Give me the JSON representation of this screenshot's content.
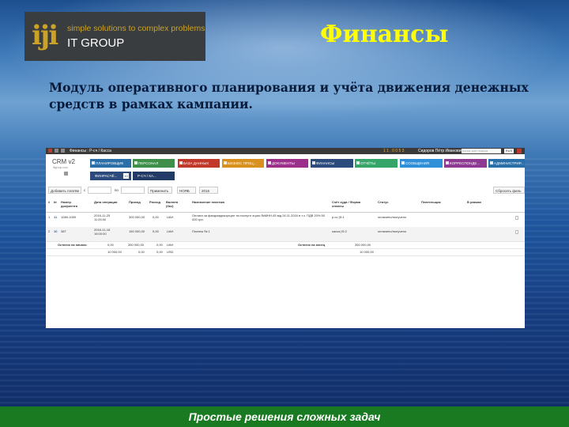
{
  "logo": {
    "mark": "iji",
    "tagline": "simple solutions to complex problems",
    "name": "IT GROUP"
  },
  "slide": {
    "title": "Финансы",
    "subtitle": "Модуль оперативного планирования и учёта движения денежных средств в рамках кампании."
  },
  "app": {
    "window_title": "Финансы : Р-сч / Касса",
    "counters": "1 1 . 0 0 5 3",
    "user": "Сидоров Пётр Иванович",
    "search_placeholder": "поиск для поиска",
    "language": "RUS",
    "logo_text": "CRM v2",
    "logo_sub": "ifigroup.com",
    "modules_row1": [
      {
        "label": "ПЛАНИРОВЩИК",
        "color": "#2a6fa8"
      },
      {
        "label": "ПЕРСОНАЛ",
        "color": "#3f8f4a"
      },
      {
        "label": "БАЗА ДАННЫХ",
        "color": "#c0392b"
      },
      {
        "label": "БИЗНЕС ПРОЦ...",
        "color": "#d8901f"
      },
      {
        "label": "ДОКУМЕНТЫ",
        "color": "#9b2f8a"
      },
      {
        "label": "ФИНАНСЫ",
        "color": "#2c4a7c"
      },
      {
        "label": "ОТЧЁТЫ",
        "color": "#35a56a"
      },
      {
        "label": "СООБЩЕНИЯ",
        "color": "#2f8fd8"
      },
      {
        "label": "КОРРЕСПОНДЕ...",
        "color": "#8e3a92"
      },
      {
        "label": "АДМИНИСТРИР...",
        "color": "#2a6fa8"
      }
    ],
    "subtabs": [
      {
        "label": "ФИНРАСЧЁ...",
        "badge": "10",
        "color": "#2c4a7c"
      },
      {
        "label": "Р-СЧ / КА...",
        "badge": "",
        "color": "#213a66"
      }
    ],
    "filters": {
      "add_button": "Добавить платёж",
      "from_label": "с",
      "to_label": "по",
      "apply_button": "Применить",
      "month": "НОЯБ",
      "year": "2016",
      "reset_button": "Сбросить филь"
    },
    "table": {
      "headers": [
        "#",
        "Id",
        "Номер документа",
        "Дата операции",
        "Приход",
        "Расход",
        "Валюта (баз)",
        "Назначение платежа",
        "Счёт куда / Форма оплаты",
        "Статус",
        "Плательщик",
        "В рамках"
      ],
      "rows": [
        {
          "n": "1",
          "id": "11",
          "doc": "1089-1090",
          "date": "2016-11-25 11:00:00",
          "income": "300 000,00",
          "expense": "0,00",
          "currency": "UAH",
          "purpose": "Оплата за фандомдекоргцил та послуги зг.рах.№МНН-45 від 24.11.2016 в т.ч. ПДВ 20% 50 000 грн.",
          "account": "р.сч |Ф.1",
          "status": "оплачено/получено"
        },
        {
          "n": "2",
          "id": "10",
          "doc": "387",
          "date": "2016-11-18 16:00:00",
          "income": "150 000,00",
          "expense": "0,00",
          "currency": "UAH",
          "purpose": "Платеж № 1",
          "account": "касса |Ф.2",
          "status": "оплачено/получено"
        }
      ],
      "summary": [
        {
          "label": "Остаток на начало",
          "a": "0,00",
          "b": "350 000,00",
          "c": "0,00",
          "cur": "UAH",
          "label2": "Остаток на конец",
          "d": "350 000,00"
        },
        {
          "label": "",
          "a": "10 000,00",
          "b": "0,00",
          "c": "0,00",
          "cur": "USD",
          "label2": "",
          "d": "10 000,00"
        }
      ]
    }
  },
  "footer": {
    "text": "Простые решения сложных задач"
  }
}
